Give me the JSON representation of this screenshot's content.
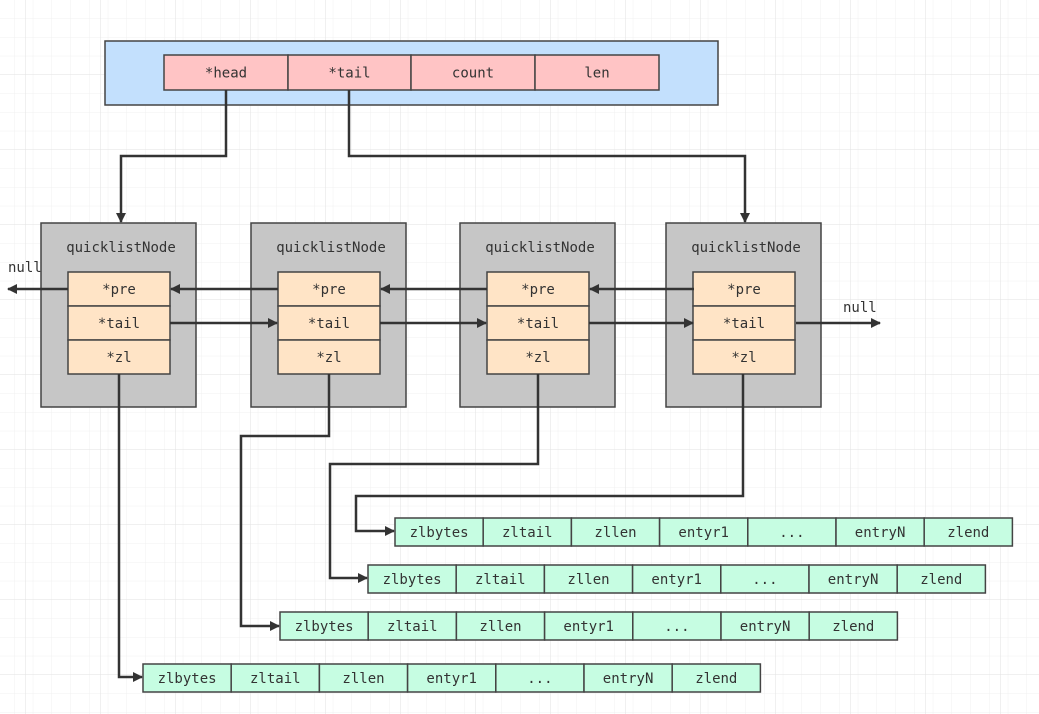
{
  "quicklist": {
    "fields": [
      "*head",
      "*tail",
      "count",
      "len"
    ]
  },
  "nodes": [
    {
      "title": "quicklistNode",
      "fields": [
        "*pre",
        "*tail",
        "*zl"
      ]
    },
    {
      "title": "quicklistNode",
      "fields": [
        "*pre",
        "*tail",
        "*zl"
      ]
    },
    {
      "title": "quicklistNode",
      "fields": [
        "*pre",
        "*tail",
        "*zl"
      ]
    },
    {
      "title": "quicklistNode",
      "fields": [
        "*pre",
        "*tail",
        "*zl"
      ]
    }
  ],
  "null_left": "null",
  "null_right": "null",
  "ziplist_fields": [
    "zlbytes",
    "zltail",
    "zllen",
    "entyr1",
    "...",
    "entryN",
    "zlend"
  ],
  "colors": {
    "quicklist_bg": "#c3e0fd",
    "quicklist_field": "#ffc4c5",
    "node_bg": "#c6c6c6",
    "node_field": "#ffe4c6",
    "ziplist_field": "#c6fde2",
    "line": "#333333"
  }
}
